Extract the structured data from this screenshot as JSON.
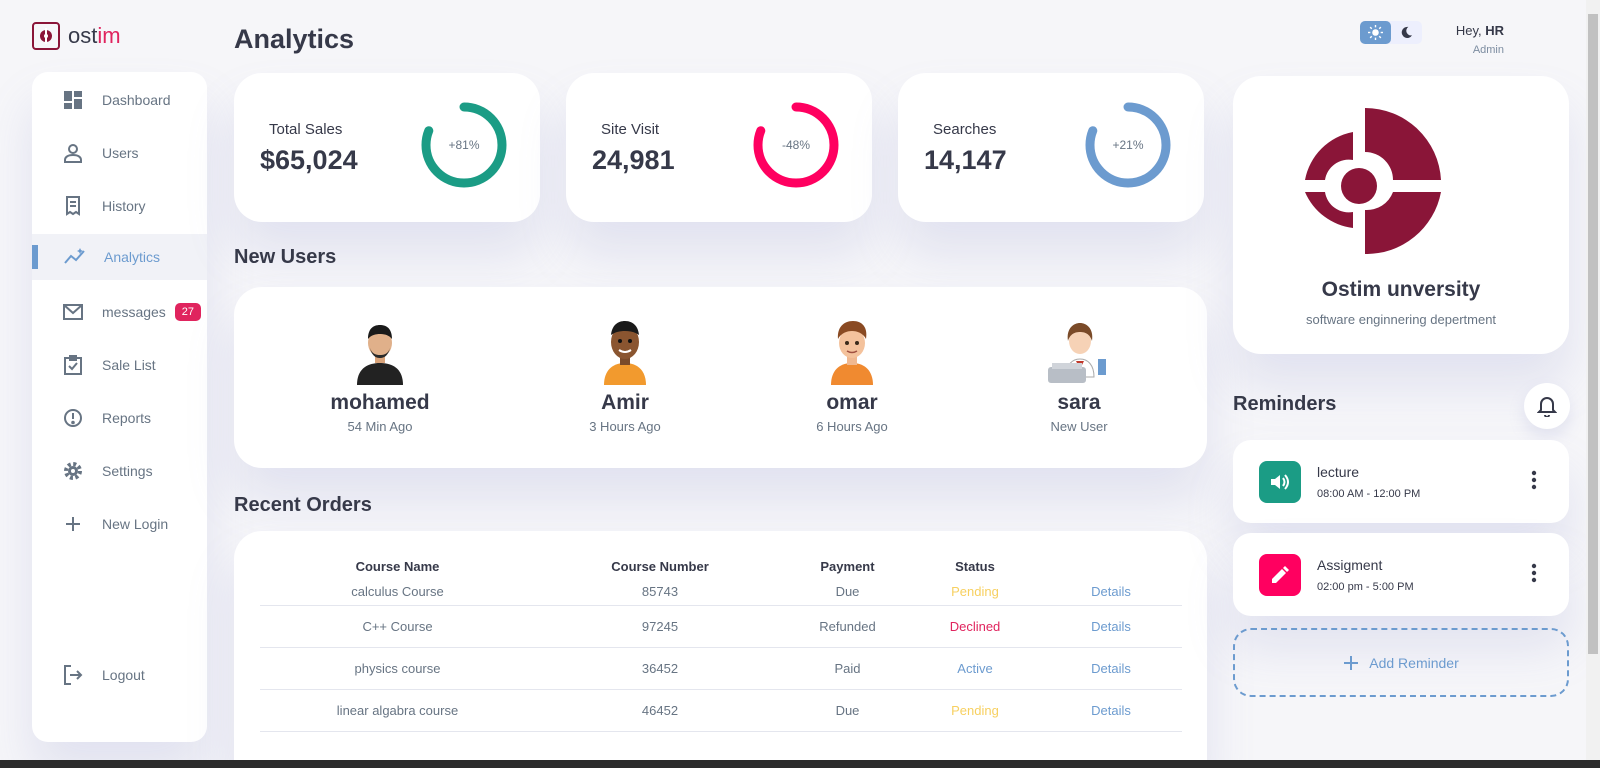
{
  "brand": {
    "name_a": "ost",
    "name_b": "im"
  },
  "page_title": "Analytics",
  "colors": {
    "primary": "#6c9bcf",
    "danger": "#e0245e",
    "success": "#1b9c85",
    "warning": "#f7d060",
    "brand": "#8a1538"
  },
  "sidebar": {
    "items": [
      {
        "label": "Dashboard",
        "icon": "dashboard-icon"
      },
      {
        "label": "Users",
        "icon": "user-icon"
      },
      {
        "label": "History",
        "icon": "receipt-icon"
      },
      {
        "label": "Analytics",
        "icon": "insights-icon",
        "active": true
      },
      {
        "label": "messages",
        "icon": "mail-icon",
        "badge": "27"
      },
      {
        "label": "Sale List",
        "icon": "clipboard-check-icon"
      },
      {
        "label": "Reports",
        "icon": "report-icon"
      },
      {
        "label": "Settings",
        "icon": "gear-icon"
      },
      {
        "label": "New Login",
        "icon": "plus-icon"
      }
    ],
    "logout": "Logout"
  },
  "stats": [
    {
      "label": "Total Sales",
      "value": "$65,024",
      "percent": "+81%",
      "progress": 0.81,
      "color": "#1b9c85"
    },
    {
      "label": "Site Visit",
      "value": "24,981",
      "percent": "-48%",
      "progress": 0.81,
      "color": "#ff0060"
    },
    {
      "label": "Searches",
      "value": "14,147",
      "percent": "+21%",
      "progress": 0.81,
      "color": "#6c9bcf"
    }
  ],
  "new_users": {
    "title": "New Users",
    "users": [
      {
        "name": "mohamed",
        "time": "54 Min Ago"
      },
      {
        "name": "Amir",
        "time": "3 Hours Ago"
      },
      {
        "name": "omar",
        "time": "6 Hours Ago"
      },
      {
        "name": "sara",
        "time": "New User"
      }
    ]
  },
  "recent_orders": {
    "title": "Recent Orders",
    "headers": [
      "Course Name",
      "Course Number",
      "Payment",
      "Status",
      ""
    ],
    "rows": [
      {
        "name": "calculus Course",
        "number": "85743",
        "payment": "Due",
        "status": "Pending",
        "action": "Details"
      },
      {
        "name": "C++ Course",
        "number": "97245",
        "payment": "Refunded",
        "status": "Declined",
        "action": "Details"
      },
      {
        "name": "physics course",
        "number": "36452",
        "payment": "Paid",
        "status": "Active",
        "action": "Details"
      },
      {
        "name": "linear algabra course",
        "number": "46452",
        "payment": "Due",
        "status": "Pending",
        "action": "Details"
      }
    ]
  },
  "header": {
    "greeting": "Hey,",
    "user": "HR",
    "role": "Admin"
  },
  "profile": {
    "name": "Ostim unversity",
    "department": "software enginnering depertment"
  },
  "reminders": {
    "title": "Reminders",
    "items": [
      {
        "title": "lecture",
        "time": "08:00 AM - 12:00 PM",
        "icon": "volume-icon",
        "color": "#1b9c85"
      },
      {
        "title": "Assigment",
        "time": "02:00 pm - 5:00 PM",
        "icon": "edit-icon",
        "color": "#ff0060"
      }
    ],
    "add_label": "Add Reminder"
  }
}
